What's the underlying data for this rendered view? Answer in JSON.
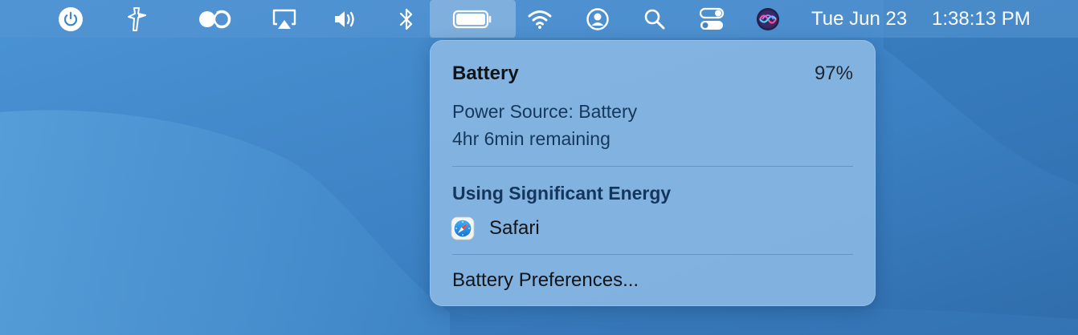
{
  "menubar": {
    "icons": [
      "power-icon",
      "tweetdeck-icon",
      "toggle-icon",
      "airplay-icon",
      "volume-icon",
      "bluetooth-icon",
      "battery-icon",
      "wifi-icon",
      "user-icon",
      "search-icon",
      "control-center-icon",
      "siri-icon"
    ],
    "clock": {
      "date": "Tue Jun 23",
      "time": "1:38:13 PM"
    }
  },
  "battery_popover": {
    "title": "Battery",
    "percent": "97%",
    "power_source": "Power Source: Battery",
    "remaining": "4hr 6min remaining",
    "significant_energy_heading": "Using Significant Energy",
    "apps": [
      {
        "name": "Safari",
        "icon": "safari-icon"
      }
    ],
    "preferences_label": "Battery Preferences..."
  },
  "colors": {
    "desktop": "#3e86c8",
    "popover": "#8cb9e4",
    "heading_blue": "#15365c"
  }
}
